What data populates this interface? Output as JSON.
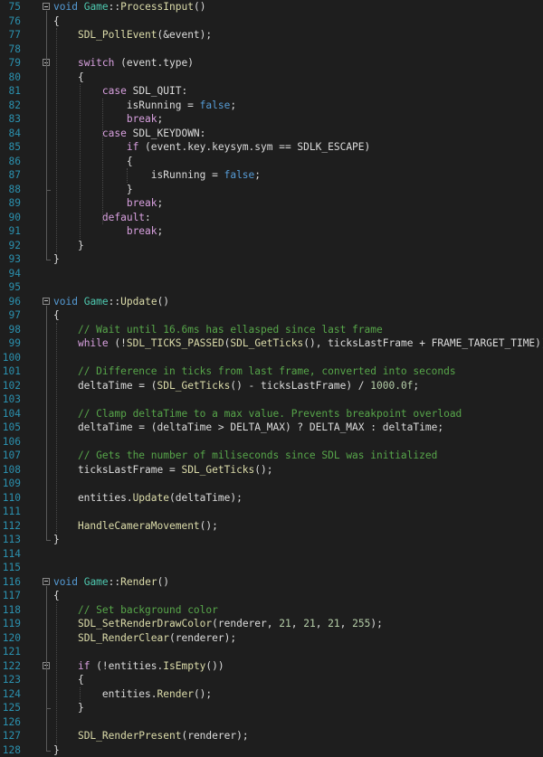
{
  "editor": {
    "lines": [
      {
        "n": "75",
        "fold": true,
        "tokens": [
          [
            "kw",
            "void"
          ],
          [
            "pl",
            " "
          ],
          [
            "ty",
            "Game"
          ],
          [
            "pl",
            "::"
          ],
          [
            "fn",
            "ProcessInput"
          ],
          [
            "pl",
            "()"
          ]
        ]
      },
      {
        "n": "76",
        "tokens": [
          [
            "pl",
            "{"
          ]
        ]
      },
      {
        "n": "77",
        "tokens": [
          [
            "pl",
            "    "
          ],
          [
            "fn",
            "SDL_PollEvent"
          ],
          [
            "pl",
            "(&event);"
          ]
        ]
      },
      {
        "n": "78",
        "tokens": []
      },
      {
        "n": "79",
        "fold": true,
        "tokens": [
          [
            "pl",
            "    "
          ],
          [
            "ctl",
            "switch"
          ],
          [
            "pl",
            " (event.type)"
          ]
        ]
      },
      {
        "n": "80",
        "tokens": [
          [
            "pl",
            "    {"
          ]
        ]
      },
      {
        "n": "81",
        "tokens": [
          [
            "pl",
            "        "
          ],
          [
            "ctl",
            "case"
          ],
          [
            "pl",
            " SDL_QUIT:"
          ]
        ]
      },
      {
        "n": "82",
        "tokens": [
          [
            "pl",
            "            isRunning = "
          ],
          [
            "kw",
            "false"
          ],
          [
            "pl",
            ";"
          ]
        ]
      },
      {
        "n": "83",
        "tokens": [
          [
            "pl",
            "            "
          ],
          [
            "ctl",
            "break"
          ],
          [
            "pl",
            ";"
          ]
        ]
      },
      {
        "n": "84",
        "tokens": [
          [
            "pl",
            "        "
          ],
          [
            "ctl",
            "case"
          ],
          [
            "pl",
            " SDL_KEYDOWN:"
          ]
        ]
      },
      {
        "n": "85",
        "tokens": [
          [
            "pl",
            "            "
          ],
          [
            "ctl",
            "if"
          ],
          [
            "pl",
            " (event.key.keysym.sym == SDLK_ESCAPE)"
          ]
        ]
      },
      {
        "n": "86",
        "tokens": [
          [
            "pl",
            "            {"
          ]
        ]
      },
      {
        "n": "87",
        "tokens": [
          [
            "pl",
            "                isRunning = "
          ],
          [
            "kw",
            "false"
          ],
          [
            "pl",
            ";"
          ]
        ]
      },
      {
        "n": "88",
        "tokens": [
          [
            "pl",
            "            }"
          ]
        ]
      },
      {
        "n": "89",
        "tokens": [
          [
            "pl",
            "            "
          ],
          [
            "ctl",
            "break"
          ],
          [
            "pl",
            ";"
          ]
        ]
      },
      {
        "n": "90",
        "tokens": [
          [
            "pl",
            "        "
          ],
          [
            "ctl",
            "default"
          ],
          [
            "pl",
            ":"
          ]
        ]
      },
      {
        "n": "91",
        "tokens": [
          [
            "pl",
            "            "
          ],
          [
            "ctl",
            "break"
          ],
          [
            "pl",
            ";"
          ]
        ]
      },
      {
        "n": "92",
        "tokens": [
          [
            "pl",
            "    }"
          ]
        ]
      },
      {
        "n": "93",
        "tokens": [
          [
            "pl",
            "}"
          ]
        ]
      },
      {
        "n": "94",
        "tokens": []
      },
      {
        "n": "95",
        "tokens": []
      },
      {
        "n": "96",
        "fold": true,
        "tokens": [
          [
            "kw",
            "void"
          ],
          [
            "pl",
            " "
          ],
          [
            "ty",
            "Game"
          ],
          [
            "pl",
            "::"
          ],
          [
            "fn",
            "Update"
          ],
          [
            "pl",
            "()"
          ]
        ]
      },
      {
        "n": "97",
        "tokens": [
          [
            "pl",
            "{"
          ]
        ]
      },
      {
        "n": "98",
        "tokens": [
          [
            "pl",
            "    "
          ],
          [
            "cm",
            "// Wait until 16.6ms has ellasped since last frame"
          ]
        ]
      },
      {
        "n": "99",
        "tokens": [
          [
            "pl",
            "    "
          ],
          [
            "ctl",
            "while"
          ],
          [
            "pl",
            " (!"
          ],
          [
            "fn",
            "SDL_TICKS_PASSED"
          ],
          [
            "pl",
            "("
          ],
          [
            "fn",
            "SDL_GetTicks"
          ],
          [
            "pl",
            "(), ticksLastFrame + FRAME_TARGET_TIME));"
          ]
        ]
      },
      {
        "n": "100",
        "tokens": []
      },
      {
        "n": "101",
        "tokens": [
          [
            "pl",
            "    "
          ],
          [
            "cm",
            "// Difference in ticks from last frame, converted into seconds"
          ]
        ]
      },
      {
        "n": "102",
        "tokens": [
          [
            "pl",
            "    deltaTime = ("
          ],
          [
            "fn",
            "SDL_GetTicks"
          ],
          [
            "pl",
            "() - ticksLastFrame) / "
          ],
          [
            "num",
            "1000.0f"
          ],
          [
            "pl",
            ";"
          ]
        ]
      },
      {
        "n": "103",
        "tokens": []
      },
      {
        "n": "104",
        "tokens": [
          [
            "pl",
            "    "
          ],
          [
            "cm",
            "// Clamp deltaTime to a max value. Prevents breakpoint overload"
          ]
        ]
      },
      {
        "n": "105",
        "tokens": [
          [
            "pl",
            "    deltaTime = (deltaTime > DELTA_MAX) ? DELTA_MAX : deltaTime;"
          ]
        ]
      },
      {
        "n": "106",
        "tokens": []
      },
      {
        "n": "107",
        "tokens": [
          [
            "pl",
            "    "
          ],
          [
            "cm",
            "// Gets the number of miliseconds since SDL was initialized"
          ]
        ]
      },
      {
        "n": "108",
        "tokens": [
          [
            "pl",
            "    ticksLastFrame = "
          ],
          [
            "fn",
            "SDL_GetTicks"
          ],
          [
            "pl",
            "();"
          ]
        ]
      },
      {
        "n": "109",
        "tokens": []
      },
      {
        "n": "110",
        "tokens": [
          [
            "pl",
            "    entities."
          ],
          [
            "fn",
            "Update"
          ],
          [
            "pl",
            "(deltaTime);"
          ]
        ]
      },
      {
        "n": "111",
        "tokens": []
      },
      {
        "n": "112",
        "tokens": [
          [
            "pl",
            "    "
          ],
          [
            "fn",
            "HandleCameraMovement"
          ],
          [
            "pl",
            "();"
          ]
        ]
      },
      {
        "n": "113",
        "tokens": [
          [
            "pl",
            "}"
          ]
        ]
      },
      {
        "n": "114",
        "tokens": []
      },
      {
        "n": "115",
        "tokens": []
      },
      {
        "n": "116",
        "fold": true,
        "tokens": [
          [
            "kw",
            "void"
          ],
          [
            "pl",
            " "
          ],
          [
            "ty",
            "Game"
          ],
          [
            "pl",
            "::"
          ],
          [
            "fn",
            "Render"
          ],
          [
            "pl",
            "()"
          ]
        ]
      },
      {
        "n": "117",
        "tokens": [
          [
            "pl",
            "{"
          ]
        ]
      },
      {
        "n": "118",
        "tokens": [
          [
            "pl",
            "    "
          ],
          [
            "cm",
            "// Set background color"
          ]
        ]
      },
      {
        "n": "119",
        "tokens": [
          [
            "pl",
            "    "
          ],
          [
            "fn",
            "SDL_SetRenderDrawColor"
          ],
          [
            "pl",
            "(renderer, "
          ],
          [
            "num",
            "21"
          ],
          [
            "pl",
            ", "
          ],
          [
            "num",
            "21"
          ],
          [
            "pl",
            ", "
          ],
          [
            "num",
            "21"
          ],
          [
            "pl",
            ", "
          ],
          [
            "num",
            "255"
          ],
          [
            "pl",
            ");"
          ]
        ]
      },
      {
        "n": "120",
        "tokens": [
          [
            "pl",
            "    "
          ],
          [
            "fn",
            "SDL_RenderClear"
          ],
          [
            "pl",
            "(renderer);"
          ]
        ]
      },
      {
        "n": "121",
        "tokens": []
      },
      {
        "n": "122",
        "fold": true,
        "tokens": [
          [
            "pl",
            "    "
          ],
          [
            "ctl",
            "if"
          ],
          [
            "pl",
            " (!entities."
          ],
          [
            "fn",
            "IsEmpty"
          ],
          [
            "pl",
            "())"
          ]
        ]
      },
      {
        "n": "123",
        "tokens": [
          [
            "pl",
            "    {"
          ]
        ]
      },
      {
        "n": "124",
        "tokens": [
          [
            "pl",
            "        entities."
          ],
          [
            "fn",
            "Render"
          ],
          [
            "pl",
            "();"
          ]
        ]
      },
      {
        "n": "125",
        "tokens": [
          [
            "pl",
            "    }"
          ]
        ]
      },
      {
        "n": "126",
        "tokens": []
      },
      {
        "n": "127",
        "tokens": [
          [
            "pl",
            "    "
          ],
          [
            "fn",
            "SDL_RenderPresent"
          ],
          [
            "pl",
            "(renderer);"
          ]
        ]
      },
      {
        "n": "128",
        "tokens": [
          [
            "pl",
            "}"
          ]
        ]
      }
    ]
  },
  "colors": {
    "background": "#1e1e1e",
    "line_number": "#2b91af",
    "keyword": "#569cd6",
    "control": "#d8a0df",
    "type": "#4ec9b0",
    "function": "#dcdcaa",
    "comment": "#57a64a",
    "number": "#b5cea8",
    "text": "#dcdcdc"
  },
  "icons": {
    "fold": "collapse-toggle-icon"
  }
}
